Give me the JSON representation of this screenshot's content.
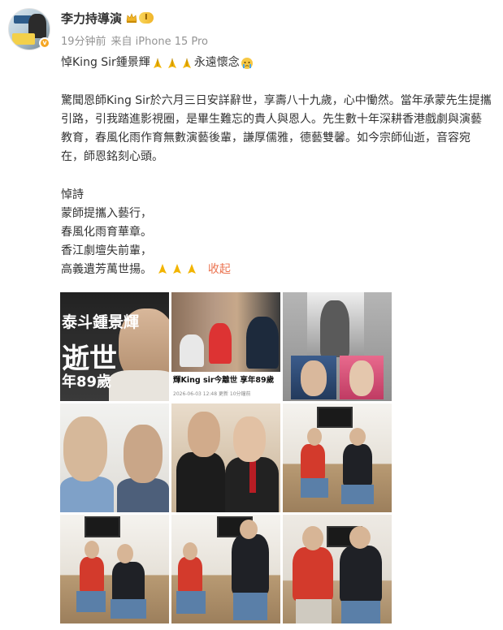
{
  "user": {
    "name": "李力持導演",
    "level": "I",
    "avatar_badge": "v"
  },
  "meta": {
    "time": "19分钟前",
    "source": "来自 iPhone 15 Pro"
  },
  "post": {
    "line1_a": "悼King Sir鍾景輝",
    "line1_b": "永遠懷念",
    "paragraph": "驚聞恩師King Sir於六月三日安詳辭世，享壽八十九歲，心中慟然。當年承蒙先生提攜引路，引我踏進影視圈，是畢生難忘的貴人與恩人。先生數十年深耕香港戲劇與演藝教育，春風化雨作育無數演藝後輩，謙厚儒雅，德藝雙馨。如今宗師仙逝，音容宛在，師恩銘刻心頭。",
    "poem_title": "悼詩",
    "poem_lines": [
      "蒙師提攜入藝行，",
      "春風化雨育華章。",
      "香江劇壇失前輩，",
      "高義遺芳萬世揚。"
    ],
    "collapse_label": "收起"
  },
  "images": {
    "img1_text1": "泰斗鍾景輝",
    "img1_text2": "逝世",
    "img1_text3": "年89歲",
    "img2_caption": "輝King sir今離世 享年89歲",
    "img2_subcaption": "2026-06-03 12:48    更新    10分鐘前"
  },
  "colors": {
    "link": "#eb7350",
    "meta": "#939393",
    "text": "#333333"
  }
}
